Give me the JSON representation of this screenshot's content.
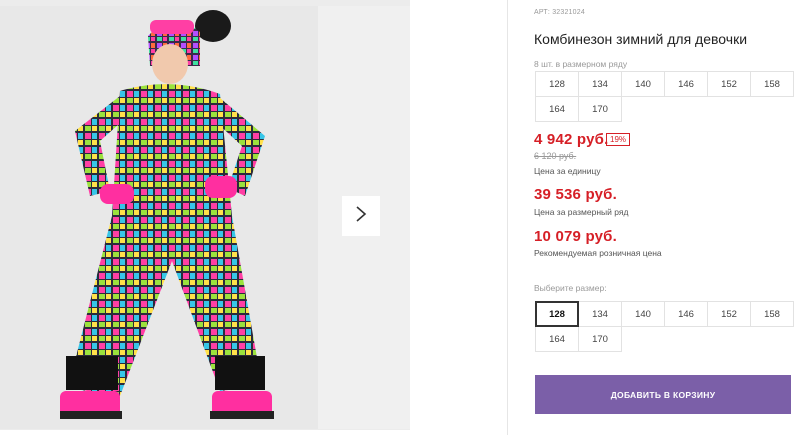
{
  "product": {
    "article": "АРТ: 32321024",
    "title": "Комбинезон зимний для девочки"
  },
  "pack": {
    "label": "8 шт. в размерном ряду",
    "sizes": [
      "128",
      "134",
      "140",
      "146",
      "152",
      "158",
      "164",
      "170"
    ]
  },
  "prices": {
    "unit_price": "4 942 руб.",
    "discount": "19%",
    "old_price": "6 120 руб.",
    "unit_label": "Цена за единицу",
    "pack_price": "39 536 руб.",
    "pack_label": "Цена за размерный ряд",
    "retail_price": "10 079 руб.",
    "retail_label": "Рекомендуемая розничная цена"
  },
  "size_select": {
    "label": "Выберите размер:",
    "selected": "128",
    "options": [
      "128",
      "134",
      "140",
      "146",
      "152",
      "158",
      "164",
      "170"
    ]
  },
  "cart": {
    "button_label": "ДОБАВИТЬ В КОРЗИНУ"
  },
  "colors": {
    "accent": "#7b5fa8",
    "price": "#d61f26"
  },
  "icons": {
    "next": "chevron-right-icon"
  }
}
